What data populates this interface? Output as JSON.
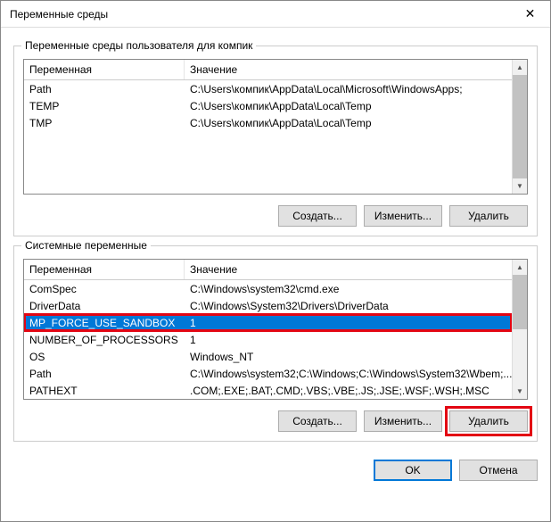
{
  "dialog": {
    "title": "Переменные среды"
  },
  "userGroup": {
    "legend": "Переменные среды пользователя для компик",
    "columns": {
      "variable": "Переменная",
      "value": "Значение"
    },
    "rows": [
      {
        "var": "Path",
        "val": "C:\\Users\\компик\\AppData\\Local\\Microsoft\\WindowsApps;"
      },
      {
        "var": "TEMP",
        "val": "C:\\Users\\компик\\AppData\\Local\\Temp"
      },
      {
        "var": "TMP",
        "val": "C:\\Users\\компик\\AppData\\Local\\Temp"
      }
    ],
    "buttons": {
      "new": "Создать...",
      "edit": "Изменить...",
      "delete": "Удалить"
    }
  },
  "systemGroup": {
    "legend": "Системные переменные",
    "columns": {
      "variable": "Переменная",
      "value": "Значение"
    },
    "rows": [
      {
        "var": "ComSpec",
        "val": "C:\\Windows\\system32\\cmd.exe",
        "selected": false
      },
      {
        "var": "DriverData",
        "val": "C:\\Windows\\System32\\Drivers\\DriverData",
        "selected": false
      },
      {
        "var": "MP_FORCE_USE_SANDBOX",
        "val": "1",
        "selected": true
      },
      {
        "var": "NUMBER_OF_PROCESSORS",
        "val": "1",
        "selected": false
      },
      {
        "var": "OS",
        "val": "Windows_NT",
        "selected": false
      },
      {
        "var": "Path",
        "val": "C:\\Windows\\system32;C:\\Windows;C:\\Windows\\System32\\Wbem;...",
        "selected": false
      },
      {
        "var": "PATHEXT",
        "val": ".COM;.EXE;.BAT;.CMD;.VBS;.VBE;.JS;.JSE;.WSF;.WSH;.MSC",
        "selected": false
      }
    ],
    "buttons": {
      "new": "Создать...",
      "edit": "Изменить...",
      "delete": "Удалить"
    }
  },
  "footer": {
    "ok": "OK",
    "cancel": "Отмена"
  }
}
